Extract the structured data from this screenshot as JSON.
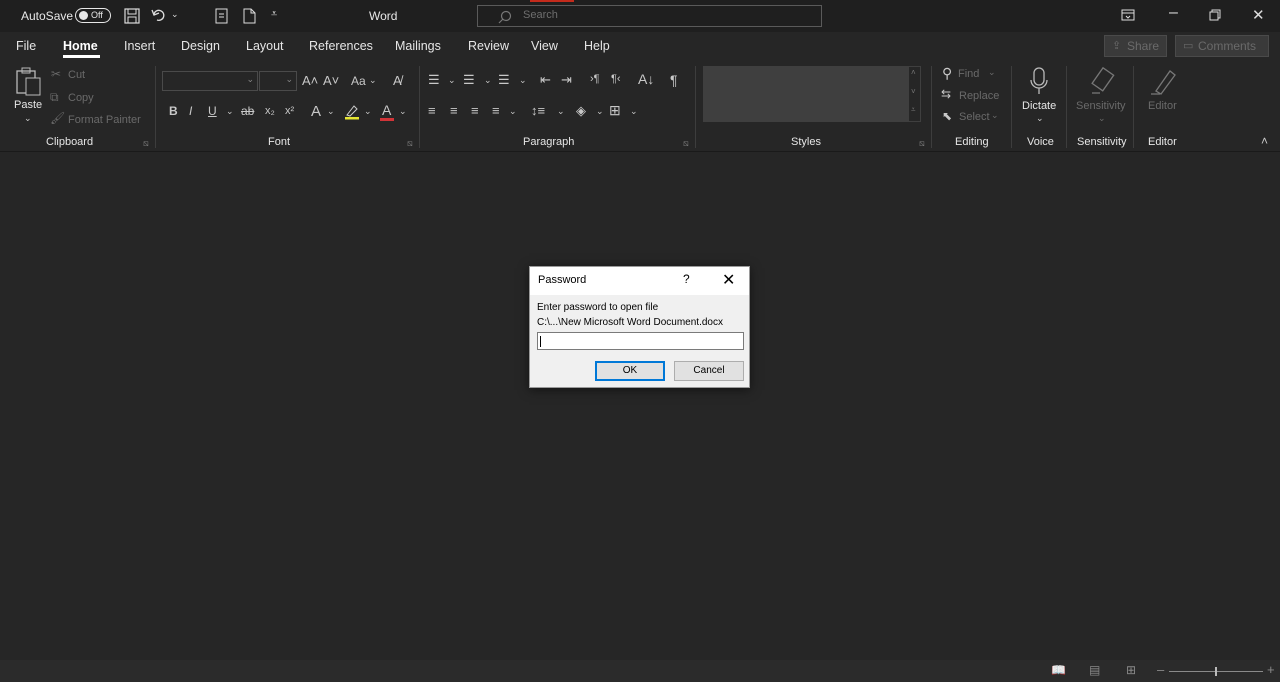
{
  "titlebar": {
    "autosave_label": "AutoSave",
    "autosave_state": "Off",
    "app_title": "Word",
    "search_placeholder": "Search"
  },
  "tabs": [
    "File",
    "Home",
    "Insert",
    "Design",
    "Layout",
    "References",
    "Mailings",
    "Review",
    "View",
    "Help"
  ],
  "actions": {
    "share": "Share",
    "comments": "Comments"
  },
  "ribbon": {
    "clipboard": {
      "paste": "Paste",
      "cut": "Cut",
      "copy": "Copy",
      "format_painter": "Format Painter",
      "label": "Clipboard"
    },
    "font": {
      "label": "Font",
      "bold": "B",
      "italic": "I",
      "underline": "U",
      "strike": "ab",
      "case": "Aa"
    },
    "paragraph": {
      "label": "Paragraph"
    },
    "styles": {
      "label": "Styles"
    },
    "editing": {
      "find": "Find",
      "replace": "Replace",
      "select": "Select",
      "label": "Editing"
    },
    "voice": {
      "dictate": "Dictate",
      "label": "Voice"
    },
    "sensitivity": {
      "button": "Sensitivity",
      "label": "Sensitivity"
    },
    "editor": {
      "button": "Editor",
      "label": "Editor"
    }
  },
  "dialog": {
    "title": "Password",
    "help": "?",
    "close": "✕",
    "prompt": "Enter password to open file",
    "path": "C:\\...\\New Microsoft Word Document.docx",
    "password_value": "",
    "ok": "OK",
    "cancel": "Cancel"
  },
  "colors": {
    "background": "#262626",
    "titlebar": "#1f1f1f",
    "dialog": "#f0f0f0",
    "focus": "#0078d7"
  }
}
